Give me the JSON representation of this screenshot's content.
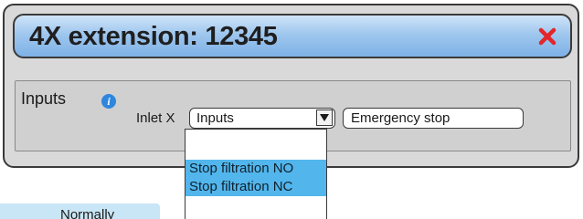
{
  "dialog": {
    "title": "4X extension: 12345",
    "close_icon": "close-x-icon",
    "colors": {
      "title_gradient_top": "#cfe4f8",
      "title_gradient_bottom": "#7eb1e6",
      "close": "#e3262b",
      "body": "#d9d9d9"
    }
  },
  "inputs": {
    "section_label": "Inputs",
    "info_icon": "info-icon",
    "inlet_label": "Inlet X",
    "select_value": "Inputs",
    "select_arrow_icon": "triangle-down-icon",
    "text_value": "Emergency stop"
  },
  "dropdown": {
    "options": [
      {
        "label": "",
        "highlighted": false
      },
      {
        "label": "Stop filtration NO",
        "highlighted": true
      },
      {
        "label": "Stop filtration NC",
        "highlighted": true
      }
    ],
    "highlight_color": "#52b6ec"
  },
  "background_tab": {
    "label": "Normally"
  }
}
